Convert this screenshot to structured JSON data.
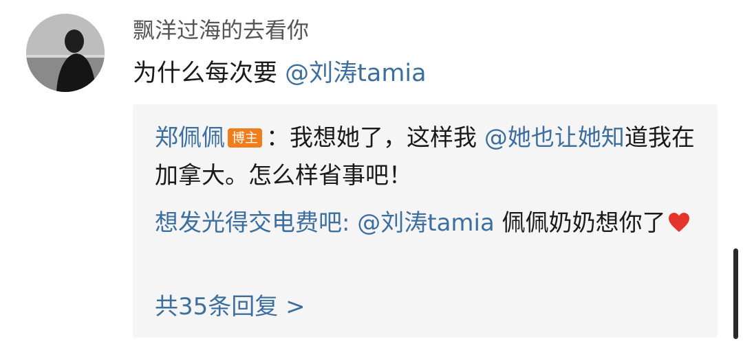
{
  "comment": {
    "username": "飘洋过海的去看你",
    "text": "为什么每次要",
    "mention": "@刘涛tamia"
  },
  "replies": [
    {
      "author": "郑佩佩",
      "badge": "博主",
      "separator": "：",
      "text_before_mention": "我想她了，这样我",
      "mention": "@她也让她知",
      "text_after_mention": "道我在加拿大。怎么样省事吧！"
    },
    {
      "author": "想发光得交电费吧",
      "separator": ": ",
      "mention": "@刘涛tamia",
      "text_after_mention": " 佩佩奶奶想你了",
      "emoji": "heart-icon"
    }
  ],
  "more_replies": "共35条回复 >",
  "colors": {
    "link": "#3c6e9e",
    "badge": "#f07d1c",
    "reply_bg": "#f5f5f5",
    "heart": "#e5342c"
  }
}
